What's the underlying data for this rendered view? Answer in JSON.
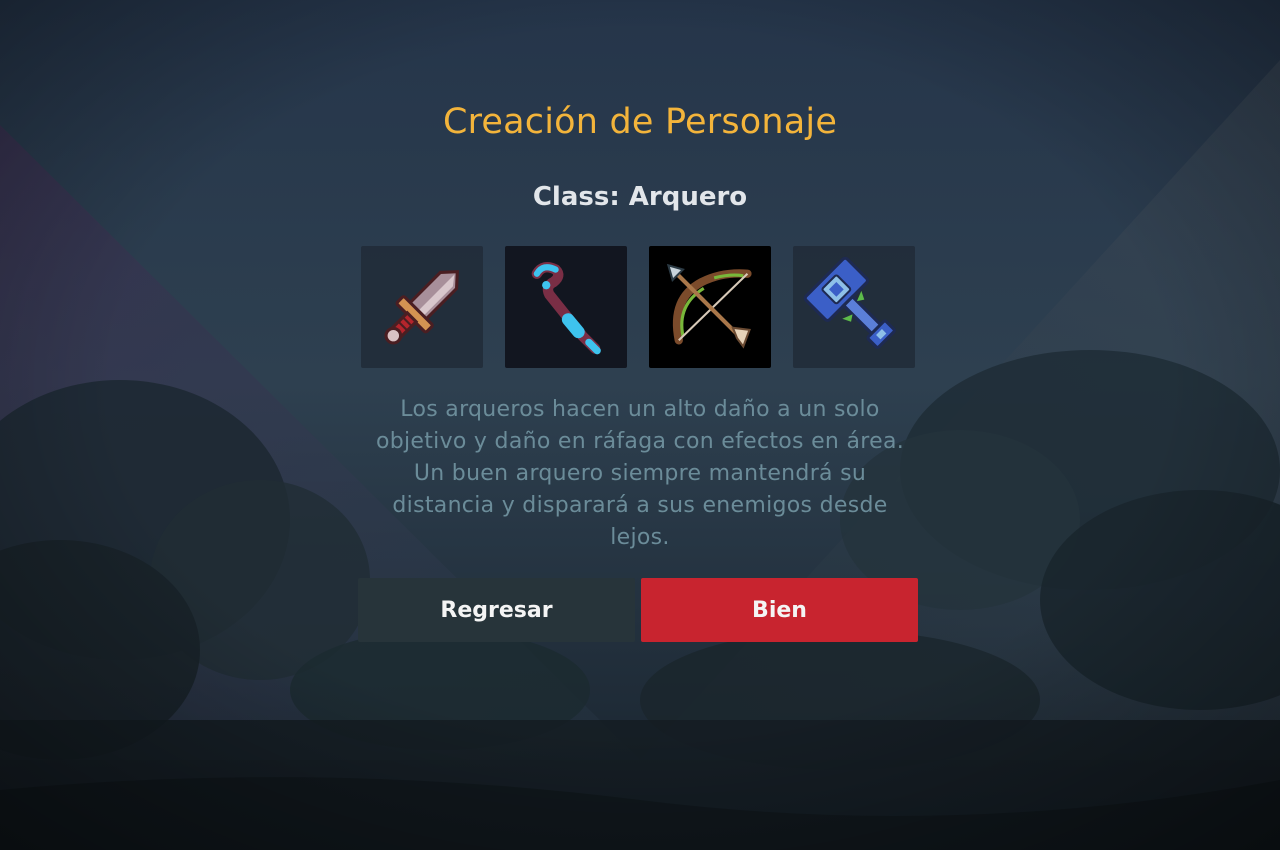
{
  "title": "Creación de Personaje",
  "class_label": "Class: Arquero",
  "weapons": [
    {
      "icon": "sword-icon",
      "selected": false
    },
    {
      "icon": "staff-icon",
      "selected": false
    },
    {
      "icon": "bow-icon",
      "selected": true
    },
    {
      "icon": "hammer-icon",
      "selected": false
    }
  ],
  "description": "Los arqueros hacen un alto daño a un solo objetivo y daño en ráfaga con efectos en área. Un buen arquero siempre mantendrá su distancia y disparará a sus enemigos desde lejos.",
  "buttons": {
    "back_label": "Regresar",
    "ok_label": "Bien"
  },
  "colors": {
    "title": "#f3b43b",
    "accent_button": "#c8242f",
    "secondary_button": "#27343a",
    "description_text": "#6b8c99"
  }
}
